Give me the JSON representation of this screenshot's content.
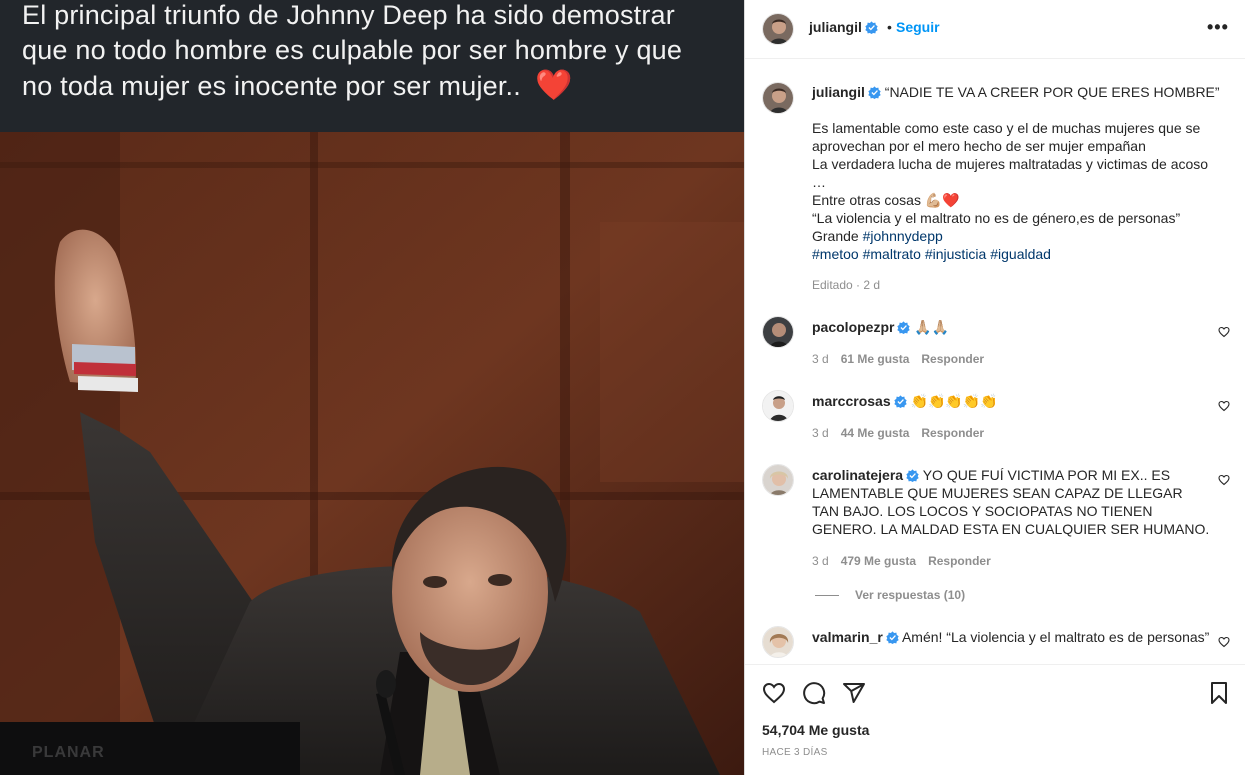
{
  "media": {
    "caption_lines": [
      "El principal triunfo de Johnny Deep ha sido demostrar",
      "que no todo hombre es culpable por ser hombre y que",
      "no toda mujer es inocente por ser mujer.."
    ],
    "caption_emoji": "❤️",
    "watermark": "PLANAR"
  },
  "header": {
    "username": "juliangil",
    "separator": "•",
    "follow_label": "Seguir",
    "more_label": "•••"
  },
  "post": {
    "username": "juliangil",
    "title": "“NADIE TE VA A CREER POR QUE ERES HOMBRE”",
    "lines": [
      "Es lamentable como este caso y el de muchas mujeres que se",
      "aprovechan por el mero hecho de ser mujer empañan",
      "La verdadera lucha de mujeres maltratadas y victimas de acoso",
      "…",
      "Entre otras cosas 💪🏼❤️",
      "“La violencia y el maltrato no es de género,es de personas”"
    ],
    "grande": "Grande",
    "hashtags_line1": [
      "#johnnydepp"
    ],
    "hashtags_line2": [
      "#metoo",
      "#maltrato",
      "#injusticia",
      "#igualdad"
    ],
    "meta": "Editado · 2 d"
  },
  "comments": [
    {
      "user": "pacolopezpr",
      "text": "🙏🏼🙏🏼",
      "age": "3 d",
      "likes": "61 Me gusta",
      "reply": "Responder"
    },
    {
      "user": "marccrosas",
      "text": "👏👏👏👏👏",
      "age": "3 d",
      "likes": "44 Me gusta",
      "reply": "Responder"
    },
    {
      "user": "carolinatejera",
      "text": "YO QUE FUÍ VICTIMA POR MI EX.. ES LAMENTABLE QUE MUJERES SEAN CAPAZ DE LLEGAR TAN BAJO. LOS LOCOS Y SOCIOPATAS NO TIENEN GENERO. LA MALDAD ESTA EN CUALQUIER SER HUMANO.",
      "age": "3 d",
      "likes": "479 Me gusta",
      "reply": "Responder",
      "view_replies": "Ver respuestas (10)"
    },
    {
      "user": "valmarin_r",
      "text": "Amén! “La violencia y el maltrato es de personas”"
    }
  ],
  "footer": {
    "likes": "54,704 Me gusta",
    "time": "HACE 3 DÍAS"
  },
  "icons": [
    "heart-icon",
    "comment-icon",
    "share-icon",
    "bookmark-icon",
    "verified-icon",
    "more-icon"
  ],
  "colors": {
    "accent": "#0095f6",
    "verified": "#3897f0",
    "hashtag": "#00376b",
    "muted": "#8e8e8e"
  }
}
